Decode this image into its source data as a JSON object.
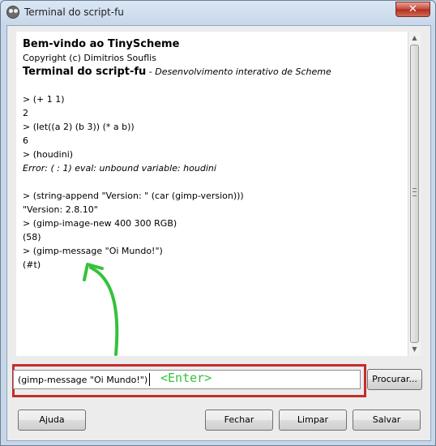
{
  "window": {
    "title": "Terminal do script-fu",
    "close_label": "✕"
  },
  "console": {
    "welcome": "Bem-vindo ao TinyScheme",
    "copyright": "Copyright (c) Dimitrios Souflis",
    "header_title": "Terminal do script-fu",
    "header_subtitle": " - Desenvolvimento interativo de Scheme",
    "lines": [
      "> (+ 1 1)",
      "2",
      "> (let((a 2) (b 3)) (* a b))",
      "6",
      "> (houdini)",
      "Error: ( : 1) eval: unbound variable: houdini",
      "> (string-append \"Version: \" (car (gimp-version)))",
      "\"Version: 2.8.10\"",
      "> (gimp-image-new 400 300 RGB)",
      "(58)",
      "> (gimp-message \"Oi Mundo!\")",
      "(#t)"
    ]
  },
  "input": {
    "value": "(gimp-message \"Oi Mundo!\")",
    "annotation": "<Enter>"
  },
  "buttons": {
    "browse": "Procurar...",
    "help": "Ajuda",
    "close": "Fechar",
    "clear": "Limpar",
    "save": "Salvar"
  },
  "colors": {
    "annotation_green": "#35c23b",
    "highlight_red": "#c62c2c"
  }
}
